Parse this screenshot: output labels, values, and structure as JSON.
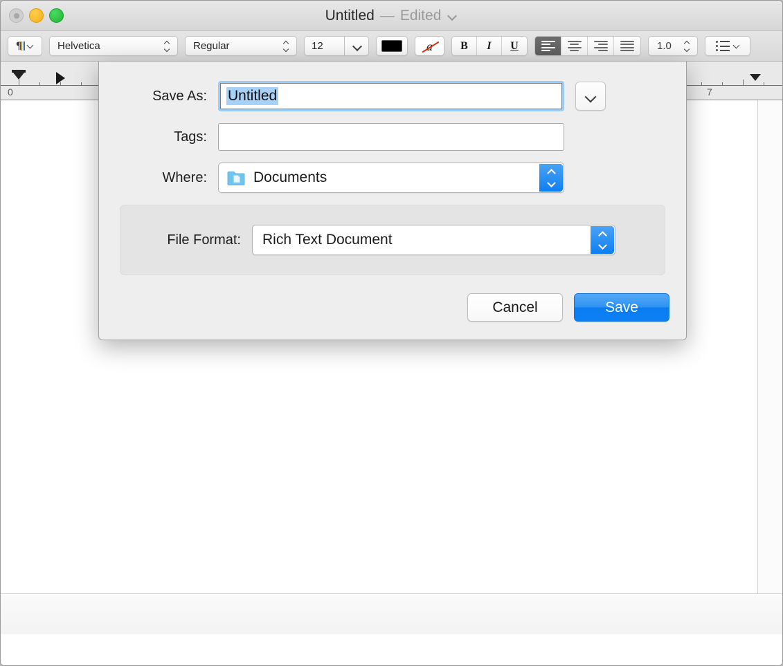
{
  "window": {
    "title_document": "Untitled",
    "title_dash": "—",
    "title_status": "Edited",
    "title_chevron_icon": "chevron-down-icon",
    "traffic_lights": {
      "close_label": "close-button",
      "minimize_label": "minimize-button",
      "zoom_label": "zoom-button"
    }
  },
  "toolbar": {
    "style_popup_icon": "pilcrow-icon",
    "font_family": "Helvetica",
    "font_style": "Regular",
    "font_size": "12",
    "color_swatch_hex": "#000000",
    "text_color_icon": "a-strikethrough-icon",
    "bold_label": "B",
    "italic_label": "I",
    "underline_label": "U",
    "align_left_icon": "align-left-icon",
    "align_center_icon": "align-center-icon",
    "align_right_icon": "align-right-icon",
    "align_justify_icon": "align-justify-icon",
    "align_selected": "left",
    "line_spacing": "1.0",
    "list_icon": "bullet-list-icon"
  },
  "ruler": {
    "numbers": [
      "0",
      "7"
    ],
    "left_indent_icon": "left-indent-marker",
    "tab_stop_icon": "tab-stop-marker",
    "right_indent_icon": "right-indent-marker"
  },
  "save_sheet": {
    "save_as_label": "Save As:",
    "save_as_value": "Untitled",
    "expand_icon": "chevron-down-icon",
    "tags_label": "Tags:",
    "tags_value": "",
    "tags_placeholder": "",
    "where_label": "Where:",
    "where_value": "Documents",
    "where_icon": "documents-folder-icon",
    "where_stepper_icon": "up-down-stepper-icon",
    "file_format_label": "File Format:",
    "file_format_value": "Rich Text Document",
    "file_format_stepper_icon": "up-down-stepper-icon",
    "cancel_label": "Cancel",
    "save_label": "Save",
    "accent_color": "#0a7cf0",
    "selection_color": "#a8d1f7",
    "focus_ring_color": "#9ccbf4"
  }
}
